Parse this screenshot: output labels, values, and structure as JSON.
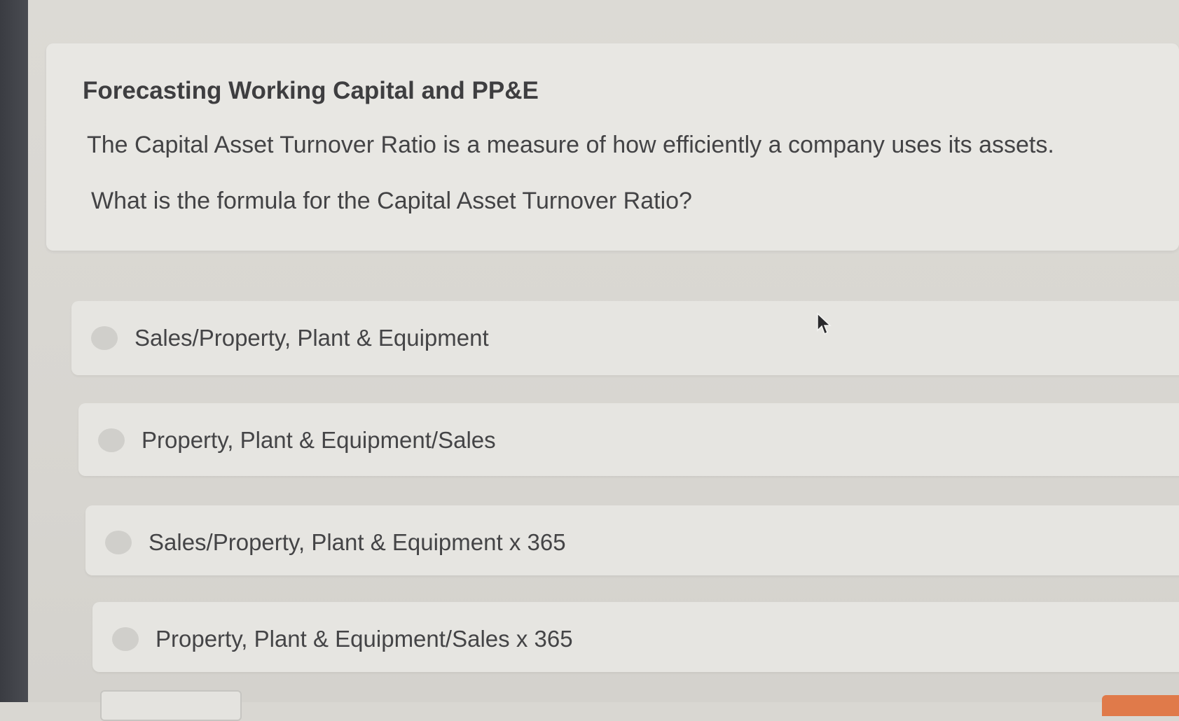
{
  "question": {
    "title": "Forecasting Working Capital and PP&E",
    "stem": "The Capital Asset Turnover Ratio is a measure of how efficiently a company uses its assets.",
    "prompt": "What is the formula for the Capital Asset Turnover Ratio?"
  },
  "options": [
    {
      "label": "Sales/Property, Plant & Equipment"
    },
    {
      "label": "Property, Plant & Equipment/Sales"
    },
    {
      "label": "Sales/Property, Plant & Equipment x 365"
    },
    {
      "label": "Property, Plant & Equipment/Sales x 365"
    }
  ],
  "colors": {
    "accent": "#e07a4a",
    "card_background": "#e8e7e3",
    "text": "#434345"
  },
  "icons": {
    "cursor": "mouse-pointer-icon",
    "radio": "radio-button"
  }
}
